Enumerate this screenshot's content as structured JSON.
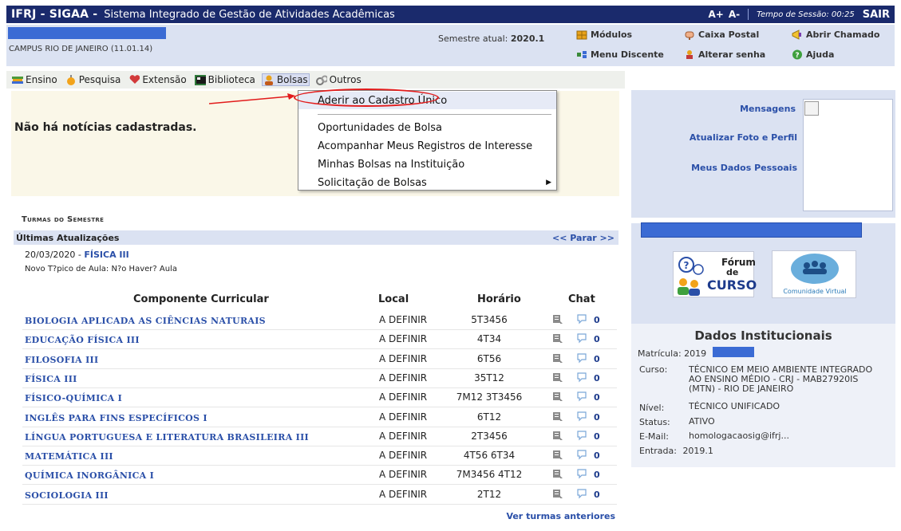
{
  "topbar": {
    "system": "IFRJ - SIGAA -",
    "description": "Sistema Integrado de Gestão de Atividades Acadêmicas",
    "font_increase": "A+",
    "font_decrease": "A-",
    "session_label": "Tempo de Sessão: 00:25",
    "logout": "SAIR"
  },
  "info": {
    "campus": "CAMPUS RIO DE JANEIRO (11.01.14)",
    "semester_label": "Semestre atual:",
    "semester_value": "2020.1",
    "links": {
      "modulos": "Módulos",
      "caixa_postal": "Caixa Postal",
      "abrir_chamado": "Abrir Chamado",
      "menu_discente": "Menu Discente",
      "alterar_senha": "Alterar senha",
      "ajuda": "Ajuda"
    }
  },
  "menu": {
    "ensino": "Ensino",
    "pesquisa": "Pesquisa",
    "extensao": "Extensão",
    "biblioteca": "Biblioteca",
    "bolsas": "Bolsas",
    "outros": "Outros"
  },
  "dropdown": {
    "items": [
      "Aderir ao Cadastro Único",
      "Oportunidades de Bolsa",
      "Acompanhar Meus Registros de Interesse",
      "Minhas Bolsas na Instituição",
      "Solicitação de Bolsas"
    ]
  },
  "news": {
    "empty": "Não há notícias cadastradas."
  },
  "turmas": {
    "title": "Turmas do Semestre",
    "ultimas": "Últimas Atualizações",
    "parar": "<< Parar >>",
    "update_date": "20/03/2020 -",
    "update_course": "FÍSICA III",
    "update_text": "Novo T?pico de Aula: N?o Haver? Aula",
    "headers": {
      "componente": "Componente Curricular",
      "local": "Local",
      "horario": "Horário",
      "chat": "Chat"
    },
    "rows": [
      {
        "name": "BIOLOGIA APLICADA AS CIÊNCIAS NATURAIS",
        "local": "A DEFINIR",
        "horario": "5T3456",
        "chat": "0"
      },
      {
        "name": "EDUCAÇÃO FÍSICA III",
        "local": "A DEFINIR",
        "horario": "4T34",
        "chat": "0"
      },
      {
        "name": "FILOSOFIA III",
        "local": "A DEFINIR",
        "horario": "6T56",
        "chat": "0"
      },
      {
        "name": "FÍSICA III",
        "local": "A DEFINIR",
        "horario": "35T12",
        "chat": "0"
      },
      {
        "name": "FÍSICO-QUÍMICA I",
        "local": "A DEFINIR",
        "horario": "7M12 3T3456",
        "chat": "0"
      },
      {
        "name": "INGLÊS PARA FINS ESPECÍFICOS I",
        "local": "A DEFINIR",
        "horario": "6T12",
        "chat": "0"
      },
      {
        "name": "LÍNGUA PORTUGUESA E LITERATURA BRASILEIRA III",
        "local": "A DEFINIR",
        "horario": "2T3456",
        "chat": "0"
      },
      {
        "name": "MATEMÁTICA III",
        "local": "A DEFINIR",
        "horario": "4T56 6T34",
        "chat": "0"
      },
      {
        "name": "QUÍMICA INORGÂNICA I",
        "local": "A DEFINIR",
        "horario": "7M3456 4T12",
        "chat": "0"
      },
      {
        "name": "SOCIOLOGIA III",
        "local": "A DEFINIR",
        "horario": "2T12",
        "chat": "0"
      }
    ],
    "ver_anteriores": "Ver turmas anteriores"
  },
  "sidebar": {
    "mensagens": "Mensagens",
    "atualizar_foto": "Atualizar Foto e Perfil",
    "meus_dados": "Meus Dados Pessoais",
    "forum_line1": "Fórum",
    "forum_line2": "de",
    "forum_line3": "CURSO",
    "comunidade": "Comunidade Virtual"
  },
  "dados": {
    "title": "Dados Institucionais",
    "matricula_label": "Matrícula:",
    "matricula_value": "2019",
    "curso_label": "Curso:",
    "curso_lines": [
      "TÉCNICO EM MEIO AMBIENTE INTEGRADO",
      "AO ENSINO MÉDIO - CRJ - MAB27920IS",
      "(MTN) - RIO DE JANEIRO"
    ],
    "nivel_label": "Nível:",
    "nivel_value": "TÉCNICO UNIFICADO",
    "status_label": "Status:",
    "status_value": "ATIVO",
    "email_label": "E-Mail:",
    "email_value": "homologacaosig@ifrj...",
    "entrada_label": "Entrada:",
    "entrada_value": "2019.1"
  },
  "colors": {
    "topbar": "#1a2a6c",
    "accent_blue": "#2a4fa8",
    "redacted_blue": "#3b6bd4",
    "panel": "#dbe2f2",
    "annotation_red": "#e21b1b"
  }
}
